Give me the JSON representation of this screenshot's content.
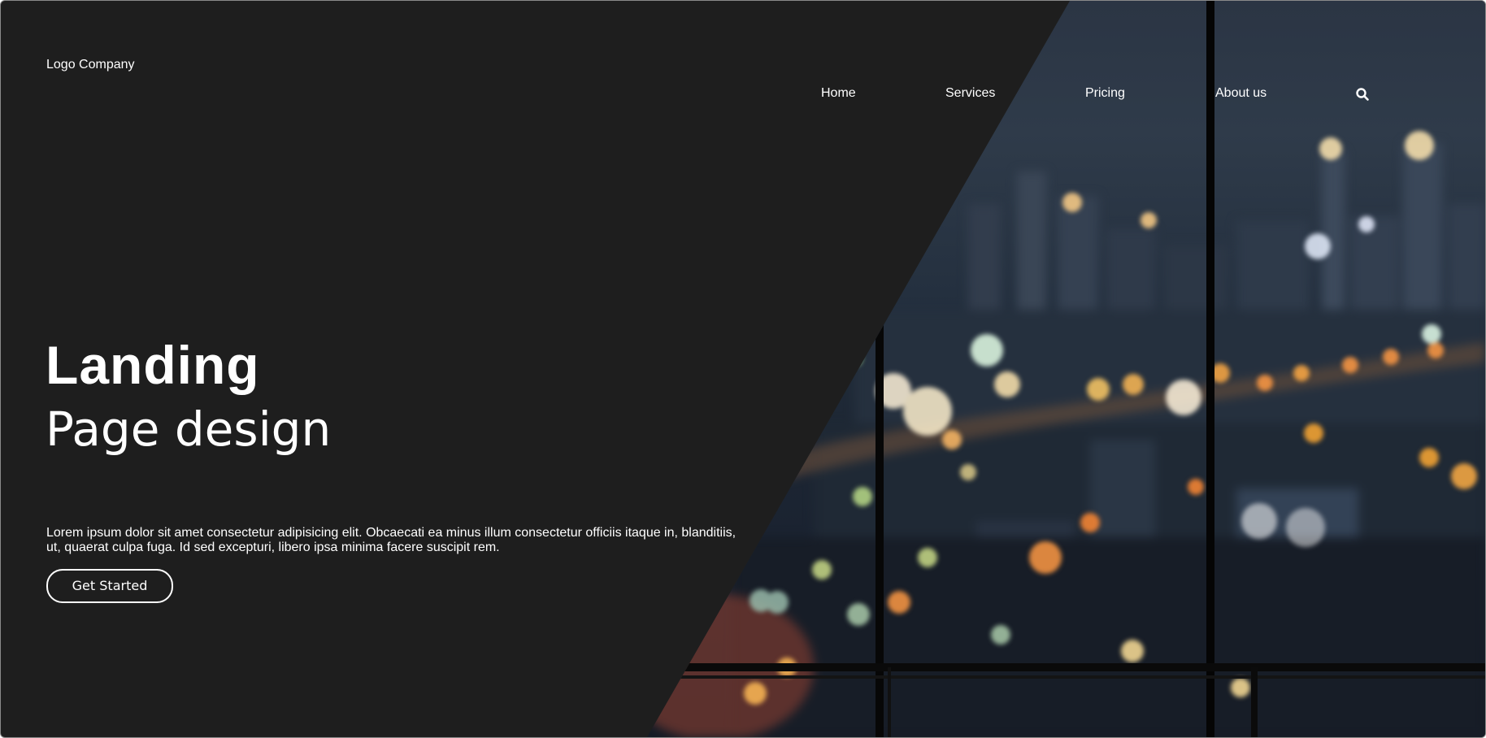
{
  "brand": {
    "logo_text": "Logo Company"
  },
  "nav": {
    "items": [
      {
        "label": "Home"
      },
      {
        "label": "Services"
      },
      {
        "label": "Pricing"
      },
      {
        "label": "About us"
      }
    ],
    "search_icon": "search-icon"
  },
  "hero": {
    "title_bold": "Landing",
    "title_light": "Page design",
    "description": "Lorem ipsum dolor sit amet consectetur adipisicing elit. Obcaecati ea minus illum consectetur officiis itaque in, blanditiis, ut, quaerat culpa fuga. Id sed excepturi, libero ipsa minima facere suscipit rem.",
    "cta_label": "Get Started",
    "background_image": "blurred city skyline at night through office window"
  },
  "colors": {
    "panel_background": "#1e1e1e",
    "text": "#ffffff",
    "border": "#8a8a8a"
  }
}
